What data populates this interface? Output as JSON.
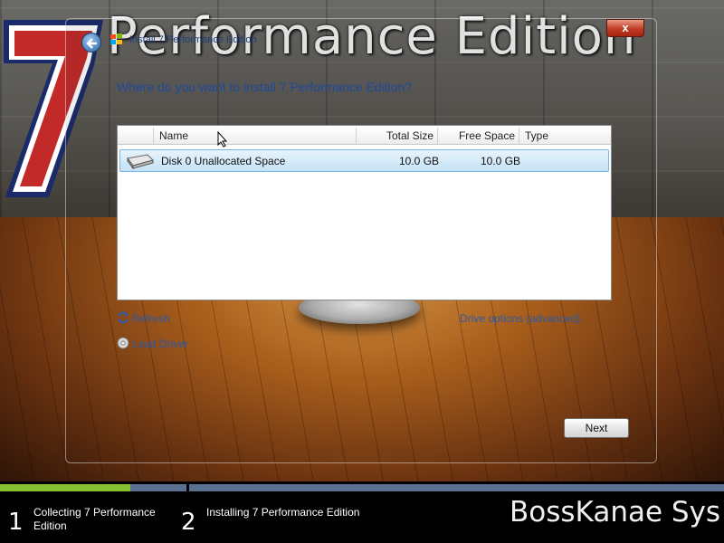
{
  "branding": {
    "title": "Performance Edition",
    "logo_numeral": "7",
    "footer_brand": "BossKanae Sys"
  },
  "window": {
    "caption": "Install 7 Performance Edition",
    "close_symbol": "x",
    "question": "Where do you want to install 7 Performance Edition?"
  },
  "table": {
    "columns": [
      "Name",
      "Total Size",
      "Free Space",
      "Type"
    ],
    "rows": [
      {
        "name": "Disk 0 Unallocated Space",
        "total": "10.0 GB",
        "free": "10.0 GB",
        "type": "",
        "selected": true
      }
    ]
  },
  "actions": {
    "refresh": "Refresh",
    "load_driver": "Load Driver",
    "drive_options": "Drive options (advanced)",
    "next": "Next"
  },
  "steps": [
    {
      "number": "1",
      "label": "Collecting 7 Performance Edition"
    },
    {
      "number": "2",
      "label": "Installing 7 Performance Edition"
    }
  ],
  "progress": {
    "step1_fraction": 0.7
  },
  "colors": {
    "accent_link": "#2a5aa8",
    "progress_green": "#86c232",
    "close_red": "#c03c24"
  },
  "icons": [
    "back-arrow-icon",
    "windows-flag-icon",
    "close-icon",
    "disk-drive-icon",
    "refresh-icon",
    "cd-icon",
    "mouse-pointer-icon"
  ]
}
